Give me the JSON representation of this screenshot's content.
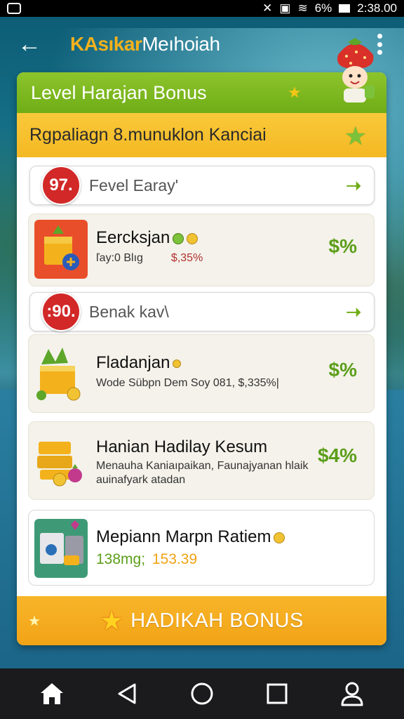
{
  "status_bar": {
    "battery": "6%",
    "time": "2:38.00"
  },
  "header": {
    "title_brand": "KAsıkar",
    "title_rest": "Meıhoiah"
  },
  "card": {
    "level_title": "Level Harajan Bonus",
    "subtitle": "Rgpaliagn 8.munuklon Kanciai"
  },
  "rows": [
    {
      "type": "level",
      "badge": "97.",
      "label": "Fevel Earay'"
    },
    {
      "type": "reward",
      "name": "Eercksjan",
      "desc_left": "ľay:0 Blıg",
      "desc_right": "$,35%",
      "pct": "$%"
    },
    {
      "type": "level",
      "badge": ":90.",
      "label": "Benak kav\\"
    },
    {
      "type": "reward",
      "name": "Fladanjan",
      "desc": "Wode Sübpn Dem Soy 081,    $,335%|",
      "pct": "$%"
    },
    {
      "type": "reward",
      "name": "Hanian Hadilay Kesum",
      "desc_line1": "Menauha Kaniaıpaikan, Faunajyanan hlaik",
      "desc_line2": "auinafyark atadan",
      "pct": "$4%"
    },
    {
      "type": "reward",
      "name": "Mepiann Marpn Ratiem",
      "desc_left": "138mg;",
      "desc_right": "153.39"
    }
  ],
  "bonus_button": {
    "label": "HADIKAH BONUS"
  },
  "colors": {
    "green": "#6fad16",
    "yellow": "#f4b823",
    "orange": "#f2a315",
    "red_badge": "#d22828"
  }
}
